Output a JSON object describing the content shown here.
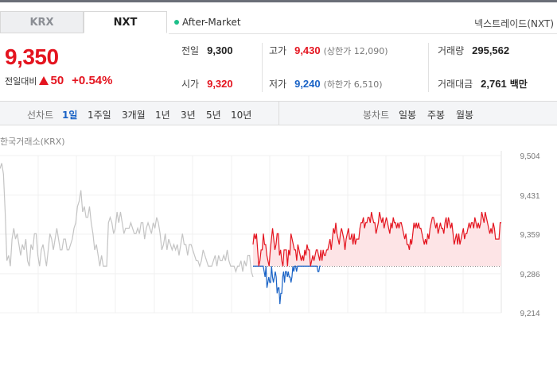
{
  "tabs": [
    {
      "label": "KRX",
      "active": false
    },
    {
      "label": "NXT",
      "active": true
    }
  ],
  "after_market": "After-Market",
  "exchange_name": "넥스트레이드(NXT)",
  "quote": {
    "price": "9,350",
    "change_label": "전일대비",
    "change_amount": "50",
    "change_percent": "+0.54%"
  },
  "stats": {
    "prev_label": "전일",
    "prev_value": "9,300",
    "high_label": "고가",
    "high_value": "9,430",
    "upper_limit": "(상한가 12,090)",
    "volume_label": "거래량",
    "volume_value": "295,562",
    "open_label": "시가",
    "open_value": "9,320",
    "low_label": "저가",
    "low_value": "9,240",
    "lower_limit": "(하한가 6,510)",
    "amount_label": "거래대금",
    "amount_value": "2,761",
    "amount_unit": "백만"
  },
  "toolbar": {
    "line_chart_label": "선차트",
    "periods": [
      "1일",
      "1주일",
      "3개월",
      "1년",
      "3년",
      "5년",
      "10년"
    ],
    "selected_period": "1일",
    "candle_label": "봉차트",
    "candle_periods": [
      "일봉",
      "주봉",
      "월봉"
    ]
  },
  "chart_title": "한국거래소(KRX)",
  "colors": {
    "up": "#e4141f",
    "down": "#1a63c6",
    "krx_line": "#c4c4c4",
    "up_fill": "#fde4e6",
    "after_market_dot": "#1dbf8a"
  },
  "chart_data": {
    "type": "line",
    "y_ticks": [
      "9,504",
      "9,431",
      "9,359",
      "9,286",
      "9,214"
    ],
    "ylim": [
      9214,
      9504
    ],
    "baseline": 9300,
    "grid": true,
    "series": [
      {
        "values": [
          9480,
          9490,
          9470,
          9400,
          9310,
          9320,
          9300,
          9350,
          9370,
          9350,
          9360,
          9340,
          9320,
          9340,
          9330,
          9350,
          9310,
          9300,
          9340,
          9330,
          9360,
          9360,
          9320,
          9300,
          9330,
          9340,
          9320,
          9300,
          9330,
          9360,
          9350,
          9330,
          9350,
          9370,
          9350,
          9330,
          9330,
          9350,
          9350,
          9330,
          9330,
          9340,
          9350,
          9370,
          9380,
          9410,
          9420,
          9440,
          9400,
          9410,
          9390,
          9390,
          9410,
          9380,
          9360,
          9330,
          9340,
          9320,
          9300,
          9320,
          9300,
          9300,
          9300,
          9380,
          9390,
          9380,
          9360,
          9370,
          9400,
          9380,
          9400,
          9380,
          9360,
          9370,
          9370,
          9370,
          9380,
          9370,
          9360,
          9360,
          9370,
          9360,
          9380,
          9380,
          9350,
          9370,
          9380,
          9370,
          9360,
          9380,
          9370,
          9390,
          9380,
          9360,
          9330,
          9340,
          9360,
          9330,
          9350,
          9340,
          9330,
          9340,
          9330,
          9340,
          9320,
          9340,
          9360,
          9340,
          9340,
          9320,
          9340,
          9340,
          9330,
          9320,
          9310,
          9310,
          9300,
          9310,
          9330,
          9320,
          9310,
          9300,
          9300,
          9300,
          9310,
          9320,
          9300,
          9320,
          9310,
          9310,
          9320,
          9310,
          9330,
          9310,
          9300,
          9300,
          9300,
          9290,
          9300,
          9300,
          9310,
          9290,
          9310,
          9300,
          9320,
          9320,
          9290,
          9280
        ]
      },
      {
        "values": [
          9300,
          9300,
          9300,
          9300,
          9300,
          9300,
          9300,
          9300,
          9300,
          9300,
          9300,
          9300,
          9290,
          9280,
          9300,
          9260,
          9270,
          9280,
          9270,
          9270,
          9300,
          9280,
          9270,
          9280,
          9290,
          9280,
          9250,
          9260,
          9260,
          9230,
          9250,
          9250,
          9280,
          9290,
          9270,
          9290,
          9290,
          9280,
          9290,
          9280,
          9280,
          9270,
          9280,
          9300,
          9290,
          9300,
          9300,
          9290,
          9300,
          9300,
          9300,
          9300,
          9300,
          9300,
          9300,
          9300,
          9300,
          9300,
          9300,
          9300,
          9300,
          9300,
          9300,
          9300,
          9300,
          9300,
          9300,
          9300,
          9300,
          9300,
          9290,
          9290,
          9300,
          9300
        ]
      },
      {
        "values": [
          9340,
          9360,
          9350,
          9360,
          9330,
          9300,
          9310,
          9330,
          9330,
          9360,
          9340,
          9340,
          9320,
          9310,
          9300,
          9330,
          9350,
          9370,
          9350,
          9330,
          9340,
          9360,
          9360,
          9320,
          9330,
          9310,
          9300,
          9330,
          9330,
          9330,
          9300,
          9330,
          9320,
          9360,
          9350,
          9340,
          9330,
          9330,
          9310,
          9340,
          9330,
          9320,
          9310,
          9320,
          9310,
          9330,
          9320,
          9340,
          9330,
          9330,
          9300,
          9310,
          9320,
          9310,
          9320,
          9330,
          9330,
          9320,
          9310,
          9330,
          9310,
          9330,
          9320,
          9320,
          9330,
          9330,
          9340,
          9350,
          9330,
          9350,
          9370,
          9360,
          9380,
          9360,
          9350,
          9340,
          9360,
          9370,
          9360,
          9350,
          9330,
          9350,
          9360,
          9370,
          9350,
          9350,
          9360,
          9340,
          9360,
          9340,
          9350,
          9350,
          9350,
          9370,
          9380,
          9380,
          9390,
          9370,
          9380,
          9380,
          9390,
          9390,
          9380,
          9400,
          9390,
          9380,
          9380,
          9360,
          9370,
          9380,
          9400,
          9390,
          9380,
          9390,
          9370,
          9380,
          9390,
          9380,
          9370,
          9360,
          9380,
          9370,
          9390,
          9380,
          9380,
          9370,
          9380,
          9370,
          9380,
          9380,
          9370,
          9360,
          9350,
          9360,
          9340,
          9340,
          9330,
          9350,
          9340,
          9360,
          9380,
          9370,
          9380,
          9370,
          9380,
          9370,
          9370,
          9360,
          9350,
          9340,
          9350,
          9340,
          9360,
          9350,
          9370,
          9380,
          9390,
          9390,
          9380,
          9370,
          9380,
          9360,
          9370,
          9380,
          9370,
          9370,
          9360,
          9380,
          9390,
          9370,
          9390,
          9380,
          9370,
          9380,
          9360,
          9340,
          9350,
          9360,
          9340,
          9360,
          9340,
          9350,
          9360,
          9370,
          9350,
          9360,
          9360,
          9370,
          9380,
          9370,
          9380,
          9380,
          9370,
          9390,
          9380,
          9370,
          9380,
          9370,
          9380,
          9400,
          9390,
          9380,
          9400,
          9390,
          9380,
          9370,
          9360,
          9370,
          9360,
          9380,
          9370,
          9350,
          9350,
          9350,
          9350,
          9380,
          9380
        ]
      }
    ]
  }
}
